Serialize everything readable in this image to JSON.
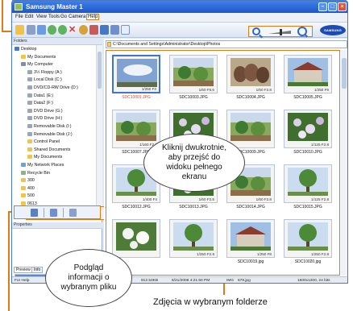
{
  "window": {
    "title": "Samsung Master 1"
  },
  "menubar": {
    "items": [
      {
        "label": "File"
      },
      {
        "label": "Edit"
      },
      {
        "label": "View"
      },
      {
        "label": "Tools"
      },
      {
        "label": "Go"
      },
      {
        "label": "Camera"
      },
      {
        "label": "Help",
        "active": true
      }
    ]
  },
  "brand": {
    "logo": "SAMSUNG"
  },
  "left_pane": {
    "folders_header": "Folders",
    "tree": [
      {
        "label": "Desktop",
        "indent": 0,
        "icon": "desktop"
      },
      {
        "label": "My Documents",
        "indent": 1,
        "icon": "folder"
      },
      {
        "label": "My Computer",
        "indent": 1,
        "icon": "computer"
      },
      {
        "label": "3½ Floppy (A:)",
        "indent": 2,
        "icon": "drive"
      },
      {
        "label": "Local Disk (C:)",
        "indent": 2,
        "icon": "drive"
      },
      {
        "label": "DVD/CD-RW Drive (D:)",
        "indent": 2,
        "icon": "drive"
      },
      {
        "label": "Data1 (E:)",
        "indent": 2,
        "icon": "drive"
      },
      {
        "label": "Data2 (F:)",
        "indent": 2,
        "icon": "drive"
      },
      {
        "label": "DVD Drive (G:)",
        "indent": 2,
        "icon": "drive"
      },
      {
        "label": "DVD Drive (H:)",
        "indent": 2,
        "icon": "drive"
      },
      {
        "label": "Removable Disk (I:)",
        "indent": 2,
        "icon": "drive"
      },
      {
        "label": "Removable Disk (J:)",
        "indent": 2,
        "icon": "drive"
      },
      {
        "label": "Control Panel",
        "indent": 2,
        "icon": "folder"
      },
      {
        "label": "Shared Documents",
        "indent": 2,
        "icon": "folder"
      },
      {
        "label": "My Documents",
        "indent": 2,
        "icon": "folder"
      },
      {
        "label": "My Network Places",
        "indent": 1,
        "icon": "network"
      },
      {
        "label": "Recycle Bin",
        "indent": 1,
        "icon": "bin"
      },
      {
        "label": "300",
        "indent": 1,
        "icon": "folder"
      },
      {
        "label": "400",
        "indent": 1,
        "icon": "folder"
      },
      {
        "label": "500",
        "indent": 1,
        "icon": "folder"
      },
      {
        "label": "0613",
        "indent": 1,
        "icon": "folder"
      }
    ],
    "properties_header": "Properties",
    "tabs": [
      {
        "label": "Preview",
        "active": true
      },
      {
        "label": "Info"
      }
    ]
  },
  "path_bar": {
    "value": "C:\\Documents and Settings\\Administrator\\Desktop\\Photos"
  },
  "thumbnails": [
    {
      "name": "SDC10001.JPG",
      "meta": "1/250 F3",
      "selected": true,
      "scene": "sky"
    },
    {
      "name": "SDC10003.JPG",
      "meta": "1/60 F5.6",
      "selected": false,
      "scene": "garden"
    },
    {
      "name": "SDC10004.JPG",
      "meta": "1/60 F2.8",
      "selected": false,
      "scene": "pots"
    },
    {
      "name": "SDC10005.JPG",
      "meta": "1/250 F9",
      "selected": false,
      "scene": "house"
    },
    {
      "name": "SDC10007.JPG",
      "meta": "1/160 F2.8",
      "selected": false,
      "scene": "garden"
    },
    {
      "name": "SDC10008.JPG",
      "meta": "",
      "selected": false,
      "scene": "flowers"
    },
    {
      "name": "SDC10009.JPG",
      "meta": "",
      "selected": false,
      "scene": "garden"
    },
    {
      "name": "SDC10010.JPG",
      "meta": "1/125 F2.8",
      "selected": false,
      "scene": "flowers"
    },
    {
      "name": "SDC10012.JPG",
      "meta": "1/400 F4",
      "selected": false,
      "scene": "tree"
    },
    {
      "name": "SDC10013.JPG",
      "meta": "1/60 F2.8",
      "selected": false,
      "scene": "flowers"
    },
    {
      "name": "SDC10014.JPG",
      "meta": "1/60 F2.8",
      "selected": false,
      "scene": "garden"
    },
    {
      "name": "SDC10015.JPG",
      "meta": "1/125 F2.8",
      "selected": false,
      "scene": "tree"
    },
    {
      "name": "",
      "meta": "",
      "selected": false,
      "scene": "white-flowers"
    },
    {
      "name": "",
      "meta": "1/250 F2.8",
      "selected": false,
      "scene": "tree"
    },
    {
      "name": "SDC10019.jpg",
      "meta": "1/250 F8",
      "selected": false,
      "scene": "house"
    },
    {
      "name": "SDC10020.jpg",
      "meta": "1/250 F2.8",
      "selected": false,
      "scene": "tree"
    }
  ],
  "statusbar": {
    "help": "For Help",
    "size": "912.53KB",
    "date": "6/21/2008 4:21:50 PM",
    "type": "IMG",
    "file": "678.jpg",
    "dimensions": "1600x1200, 24 bits"
  },
  "callouts": {
    "center": "Kliknij dwukrotnie, aby przejść do widoku pełnego ekranu",
    "preview": "Podgląd informacji o wybranym pliku",
    "caption": "Zdjęcia w wybranym folderze"
  },
  "colors": {
    "callout": "#e07a16",
    "titlebar": "#2a66d8",
    "selected_name": "#e04b2a"
  }
}
